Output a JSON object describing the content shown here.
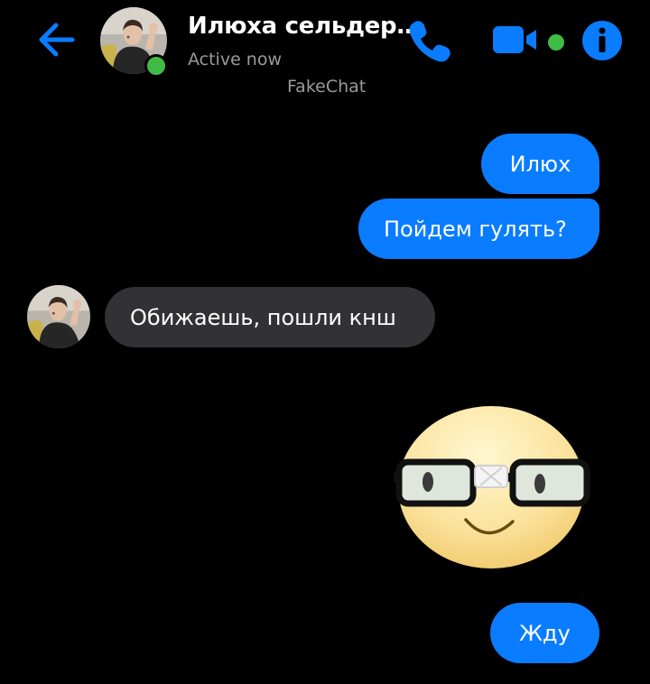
{
  "header": {
    "contact_name": "Илюха сельдер…",
    "status": "Active now",
    "watermark": "FakeChat",
    "icons": {
      "back": "arrow-left-icon",
      "call": "phone-icon",
      "video": "video-camera-icon",
      "info": "info-icon"
    }
  },
  "messages": [
    {
      "direction": "outgoing",
      "text": "Илюх"
    },
    {
      "direction": "outgoing",
      "text": "Пойдем гулять?"
    },
    {
      "direction": "incoming",
      "text": "Обижаешь, пошли кнш"
    },
    {
      "direction": "outgoing",
      "type": "sticker",
      "sticker": "nerd-face-glasses-sticker"
    },
    {
      "direction": "outgoing",
      "text": "Жду"
    }
  ],
  "colors": {
    "accent": "#0a7cff",
    "background": "#000000",
    "incoming_bubble": "#323235",
    "online": "#3fbb46",
    "secondary_text": "#9a9a9a"
  }
}
